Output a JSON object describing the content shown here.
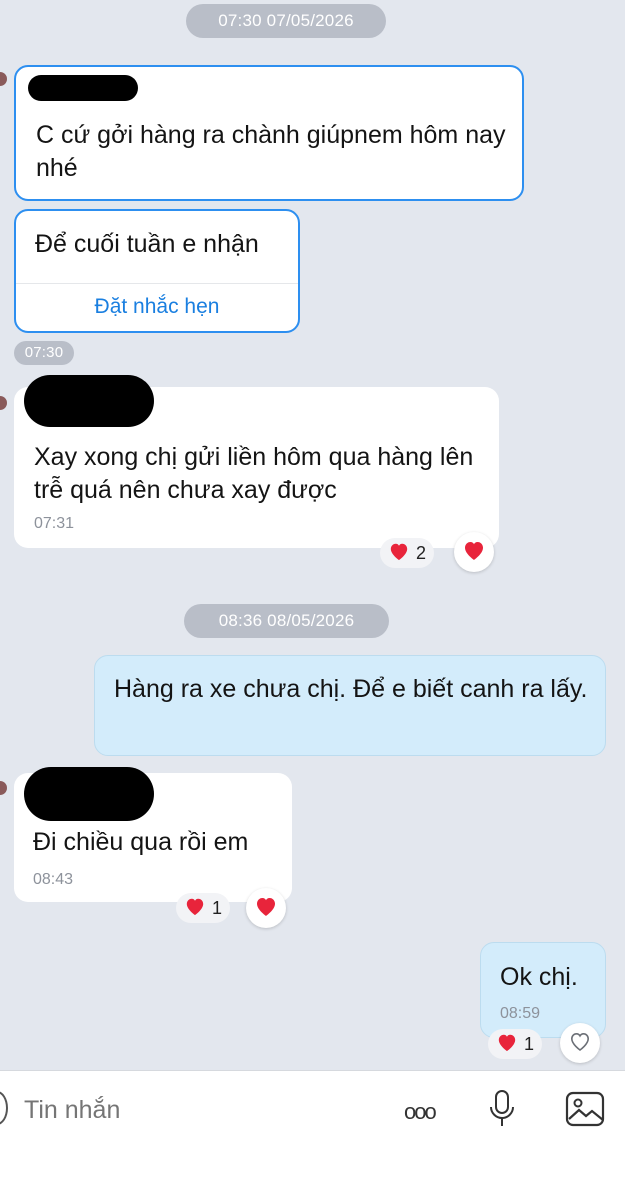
{
  "date_separators": [
    "07:30 07/05/2026",
    "08:36 08/05/2026"
  ],
  "messages": [
    {
      "text": "C cứ gởi hàng ra chành giúpnem hôm nay nhé"
    },
    {
      "text": "Để cuối tuần e nhận",
      "action": "Đặt nhắc hẹn",
      "time": "07:30"
    },
    {
      "text": "Xay xong chị gửi liền hôm qua hàng lên trễ quá nên chưa xay được",
      "time": "07:31",
      "reaction_count": "2"
    },
    {
      "text": "Hàng ra xe chưa chị. Để e biết canh ra lấy."
    },
    {
      "text": "Đi chiều qua rồi em",
      "time": "08:43",
      "reaction_count": "1"
    },
    {
      "text": "Ok chị.",
      "time": "08:59",
      "reaction_count": "1"
    }
  ],
  "input": {
    "placeholder": "Tin nhắn",
    "more_label": "ooo"
  },
  "colors": {
    "heart": "#e8243b",
    "outline": "#2d8ff0",
    "link": "#1a7fe0",
    "mine_bubble": "#d3ecfb"
  }
}
